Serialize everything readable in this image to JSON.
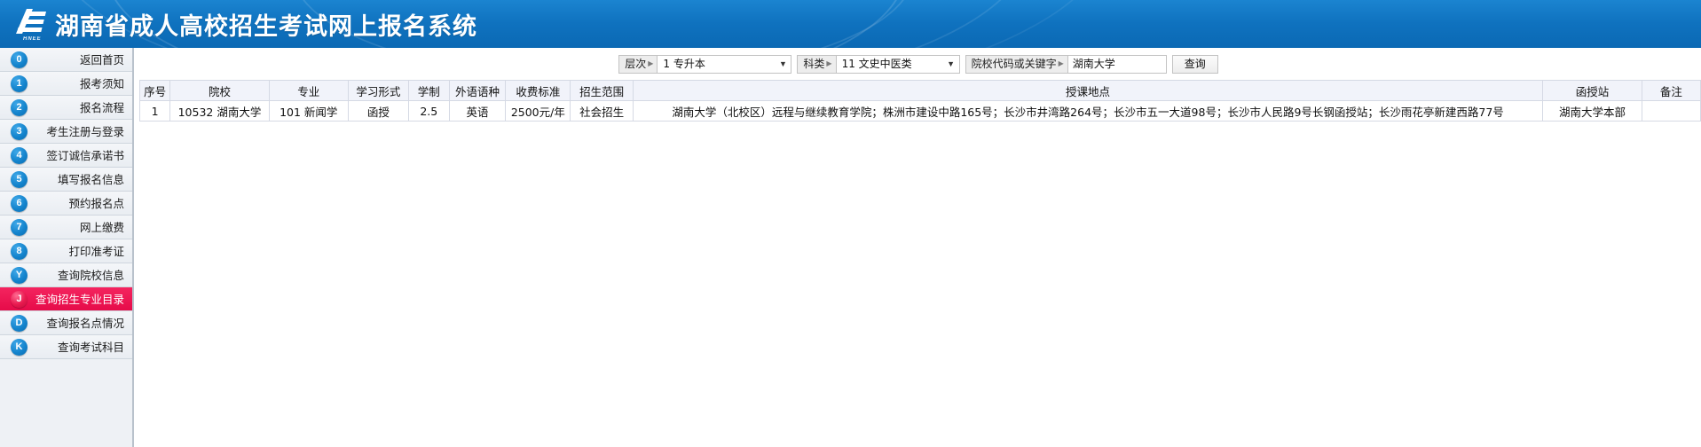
{
  "header": {
    "title": "湖南省成人高校招生考试网上报名系统",
    "logo_name": "hnzk-logo",
    "logo_subtext": "HNEE",
    "brand_color": "#1177c4"
  },
  "sidebar": {
    "selected_key": "J",
    "selected_color": "#e60b49",
    "badge_color": "#1484cd",
    "items": [
      {
        "key": "0",
        "label": "返回首页",
        "selected": false
      },
      {
        "key": "1",
        "label": "报考须知",
        "selected": false
      },
      {
        "key": "2",
        "label": "报名流程",
        "selected": false
      },
      {
        "key": "3",
        "label": "考生注册与登录",
        "selected": false
      },
      {
        "key": "4",
        "label": "签订诚信承诺书",
        "selected": false
      },
      {
        "key": "5",
        "label": "填写报名信息",
        "selected": false
      },
      {
        "key": "6",
        "label": "预约报名点",
        "selected": false
      },
      {
        "key": "7",
        "label": "网上缴费",
        "selected": false
      },
      {
        "key": "8",
        "label": "打印准考证",
        "selected": false
      },
      {
        "key": "Y",
        "label": "查询院校信息",
        "selected": false
      },
      {
        "key": "J",
        "label": "查询招生专业目录",
        "selected": true
      },
      {
        "key": "D",
        "label": "查询报名点情况",
        "selected": false
      },
      {
        "key": "K",
        "label": "查询考试科目",
        "selected": false
      }
    ]
  },
  "toolbar": {
    "level_select": {
      "label": "层次",
      "value": "1 专升本",
      "caret_icon": "caret-right-icon",
      "arrow_icon": "chevron-down-icon"
    },
    "category_select": {
      "label": "科类",
      "value": "11 文史中医类",
      "caret_icon": "caret-right-icon",
      "arrow_icon": "chevron-down-icon"
    },
    "keyword_input": {
      "label": "院校代码或关键字",
      "value": "湖南大学",
      "placeholder": "院校代码或关键字",
      "caret_icon": "caret-right-icon"
    },
    "search_button": "查询"
  },
  "table": {
    "columns": [
      "序号",
      "院校",
      "专业",
      "学习形式",
      "学制",
      "外语语种",
      "收费标准",
      "招生范围",
      "授课地点",
      "函授站",
      "备注"
    ],
    "rows": [
      {
        "no": "1",
        "school": "10532 湖南大学",
        "major": "101 新闻学",
        "form": "函授",
        "length": "2.5",
        "language": "英语",
        "fee": "2500元/年",
        "scope": "社会招生",
        "place": "湖南大学（北校区）远程与继续教育学院；株洲市建设中路165号；长沙市井湾路264号；长沙市五一大道98号；长沙市人民路9号长钢函授站；长沙雨花亭新建西路77号",
        "station": "湖南大学本部",
        "remark": ""
      }
    ]
  }
}
